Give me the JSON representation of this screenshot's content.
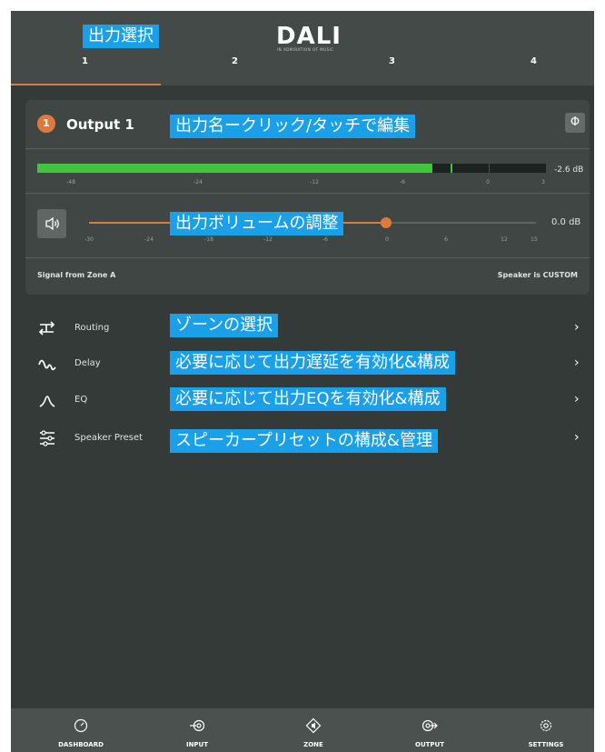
{
  "brand": {
    "name": "DALI",
    "tagline": "IN ADMIRATION OF MUSIC"
  },
  "tabs": [
    {
      "label": "1"
    },
    {
      "label": "2"
    },
    {
      "label": "3"
    },
    {
      "label": "4"
    }
  ],
  "active_tab": "1",
  "output": {
    "number": "1",
    "title": "Output 1",
    "phase_symbol": "Φ",
    "meter_value": "-2.6 dB",
    "meter_level_db": -2.6,
    "meter_ticks": [
      "-48",
      "-24",
      "-12",
      "-6",
      "0",
      "3"
    ],
    "volume_value": "0.0 dB",
    "volume_ticks": [
      "-30",
      "-24",
      "-18",
      "-12",
      "-6",
      "0",
      "6",
      "12",
      "15"
    ],
    "signal_source": "Signal from Zone A",
    "speaker_status": "Speaker is CUSTOM"
  },
  "menu": [
    {
      "label": "Routing",
      "icon": "routing-icon"
    },
    {
      "label": "Delay",
      "icon": "delay-wave-icon"
    },
    {
      "label": "EQ",
      "icon": "eq-curve-icon"
    },
    {
      "label": "Speaker Preset",
      "icon": "sliders-icon"
    }
  ],
  "annotations": {
    "output_select": "出力選択",
    "output_name": "出力名ークリック/タッチで編集",
    "output_volume": "出力ボリュームの調整",
    "routing": "ゾーンの選択",
    "delay": "必要に応じて出力遅延を有効化&構成",
    "eq": "必要に応じて出力EQを有効化&構成",
    "speaker_preset": "スピーカープリセットの構成&管理"
  },
  "bottom_nav": [
    {
      "label": "DASHBOARD",
      "icon": "gauge-icon"
    },
    {
      "label": "INPUT",
      "icon": "input-icon"
    },
    {
      "label": "ZONE",
      "icon": "zone-icon"
    },
    {
      "label": "OUTPUT",
      "icon": "output-icon"
    },
    {
      "label": "SETTINGS",
      "icon": "gear-icon"
    }
  ],
  "colors": {
    "accent": "#e07a3c",
    "meter": "#3fc63c",
    "annotation": "#1aa0e8",
    "background": "#333a38"
  }
}
